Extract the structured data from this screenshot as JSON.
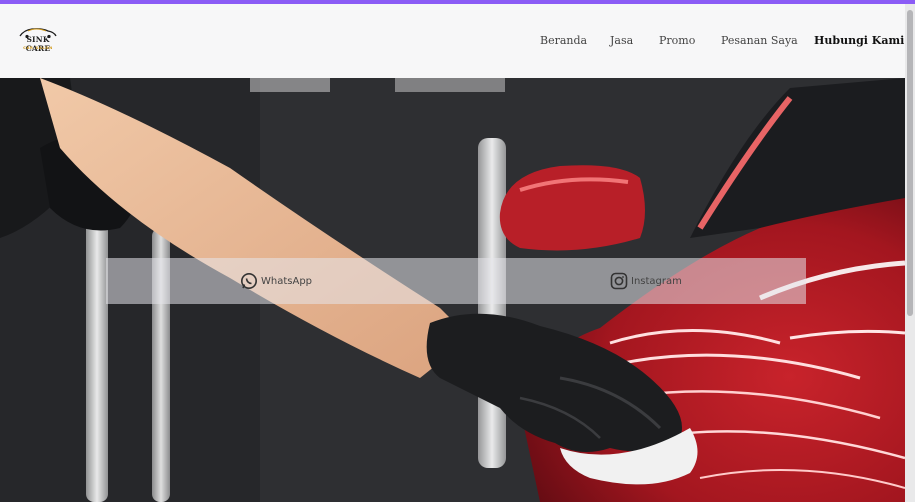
{
  "brand": {
    "logo_text": "SINK CARE",
    "logo_subtext": "CAR SALON"
  },
  "nav": {
    "items": [
      {
        "label": "Beranda"
      },
      {
        "label": "Jasa"
      },
      {
        "label": "Promo"
      },
      {
        "label": "Pesanan Saya"
      },
      {
        "label": "Hubungi Kami"
      }
    ],
    "active_item": "Hubungi Kami"
  },
  "social": {
    "whatsapp": {
      "label": "WhatsApp",
      "icon": "whatsapp-icon"
    },
    "instagram": {
      "label": "Instagram",
      "icon": "instagram-icon"
    }
  },
  "colors": {
    "top_accent": "#8b5cf6",
    "header_bg": "#f7f7f8",
    "car_red": "#b51c25"
  }
}
